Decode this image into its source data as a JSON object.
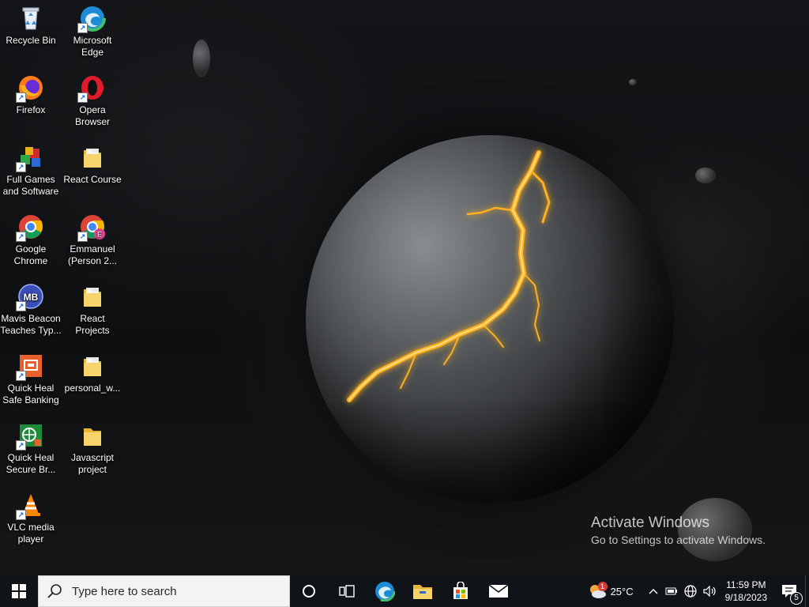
{
  "desktop": {
    "icons": [
      {
        "label": "Recycle Bin",
        "icon": "recycle-bin-icon"
      },
      {
        "label": "Microsoft Edge",
        "icon": "edge-icon"
      },
      {
        "label": "Firefox",
        "icon": "firefox-icon"
      },
      {
        "label": "Opera Browser",
        "icon": "opera-icon"
      },
      {
        "label": "Full Games and Software",
        "icon": "games-icon"
      },
      {
        "label": "React Course",
        "icon": "folder-icon"
      },
      {
        "label": "Google Chrome",
        "icon": "chrome-icon"
      },
      {
        "label": "Emmanuel (Person 2...",
        "icon": "chrome-profile-icon",
        "badge": "E"
      },
      {
        "label": "Mavis Beacon Teaches Typ...",
        "icon": "mavis-beacon-icon",
        "badge": "MB"
      },
      {
        "label": "React Projects",
        "icon": "folder-icon"
      },
      {
        "label": "Quick Heal Safe Banking",
        "icon": "quick-heal-banking-icon"
      },
      {
        "label": "personal_w...",
        "icon": "folder-icon"
      },
      {
        "label": "Quick Heal Secure Br...",
        "icon": "quick-heal-browser-icon"
      },
      {
        "label": "Javascript project",
        "icon": "folder-icon"
      },
      {
        "label": "VLC media player",
        "icon": "vlc-icon"
      }
    ]
  },
  "watermark": {
    "title": "Activate Windows",
    "subtitle": "Go to Settings to activate Windows."
  },
  "taskbar": {
    "search_placeholder": "Type here to search",
    "weather_temp": "25°C",
    "weather_badge": "1",
    "time": "11:59 PM",
    "date": "9/18/2023",
    "notification_count": "5"
  },
  "colors": {
    "taskbar_bg": "#101418",
    "search_bg": "#f3f3f3",
    "folder_yellow": "#f0c14b"
  }
}
